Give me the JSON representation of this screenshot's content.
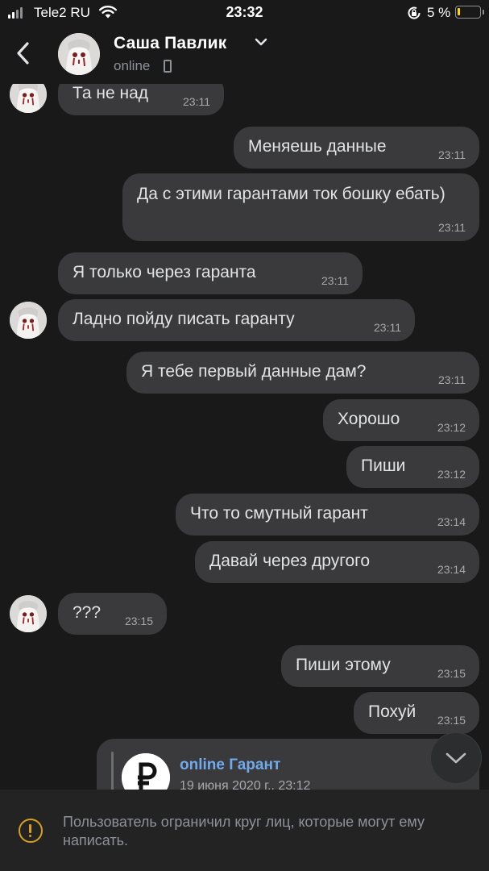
{
  "status_bar": {
    "carrier": "Tele2 RU",
    "time": "23:32",
    "battery_percent": "5 %",
    "battery_level": 0.05,
    "battery_color": "#ffd60a"
  },
  "header": {
    "contact_name": "Саша Павлик",
    "status": "online",
    "icons": [
      "chevron-left-icon",
      "chevron-down-icon",
      "phone-icon"
    ]
  },
  "messages": [
    {
      "direction": "in",
      "text": "Та не над",
      "time": "23:11",
      "avatar": true
    },
    {
      "direction": "out",
      "text": "Меняешь данные",
      "time": "23:11"
    },
    {
      "direction": "out",
      "text": "Да с этими гарантами ток бошку ебать)",
      "time": "23:11"
    },
    {
      "direction": "in",
      "text": "Я только через гаранта",
      "time": "23:11",
      "avatar": false
    },
    {
      "direction": "in",
      "text": "Ладно пойду писать гаранту",
      "time": "23:11",
      "avatar": true
    },
    {
      "direction": "out",
      "text": "Я тебе первый данные дам?",
      "time": "23:11"
    },
    {
      "direction": "out",
      "text": "Хорошо",
      "time": "23:12"
    },
    {
      "direction": "out",
      "text": "Пиши",
      "time": "23:12"
    },
    {
      "direction": "out",
      "text": "Что то смутный гарант",
      "time": "23:14"
    },
    {
      "direction": "out",
      "text": "Давай через другого",
      "time": "23:14"
    },
    {
      "direction": "in",
      "text": "???",
      "time": "23:15",
      "avatar": true
    },
    {
      "direction": "out",
      "text": "Пиши этому",
      "time": "23:15"
    },
    {
      "direction": "out",
      "text": "Похуй",
      "time": "23:15"
    }
  ],
  "forwarded": {
    "title": "online Гарант",
    "date": "19 июня 2020 г., 23:12"
  },
  "restriction": {
    "text": "Пользователь ограничил круг лиц, которые могут ему написать.",
    "icon": "warning-icon",
    "color": "#d9a01a"
  },
  "colors": {
    "background": "#19191a",
    "bubble": "#3a3a3c",
    "link": "#71aaeb"
  }
}
